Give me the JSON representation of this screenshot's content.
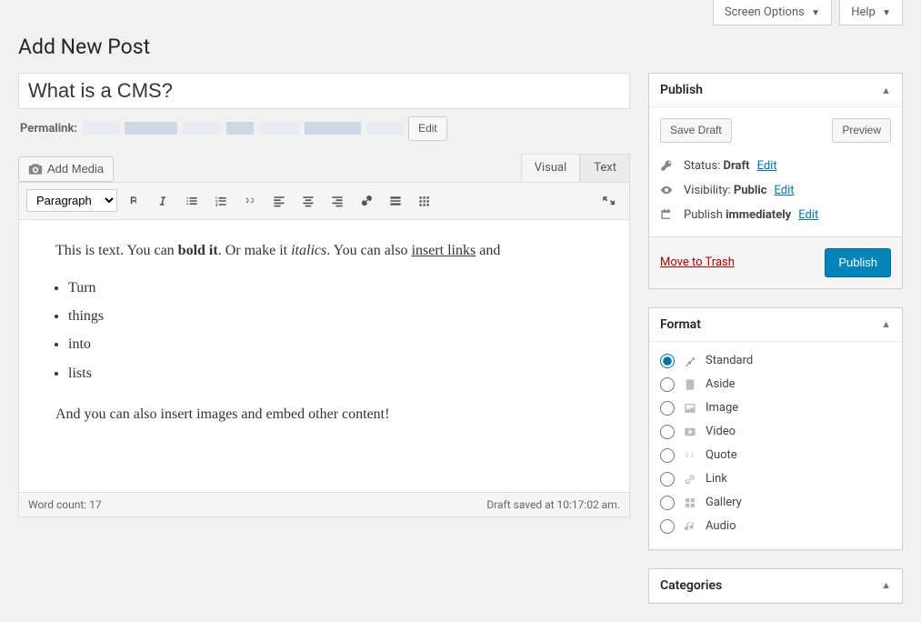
{
  "topTabs": {
    "screenOptions": "Screen Options",
    "help": "Help"
  },
  "pageTitle": "Add New Post",
  "post": {
    "title": "What is a CMS?",
    "permalinkLabel": "Permalink:",
    "editBtn": "Edit"
  },
  "mediaBtn": "Add Media",
  "editorTabs": {
    "visual": "Visual",
    "text": "Text"
  },
  "toolbar": {
    "paragraph": "Paragraph"
  },
  "content": {
    "line1_a": "This is text. You can ",
    "line1_bold": "bold it",
    "line1_b": ". Or make it ",
    "line1_italic": "italics",
    "line1_c": ". You can also ",
    "line1_link": "insert links",
    "line1_d": " and",
    "list": [
      "Turn",
      "things",
      "into",
      "lists"
    ],
    "line2": "And you can also insert images and embed other content!"
  },
  "footer": {
    "wordCountLabel": "Word count: ",
    "wordCount": "17",
    "saved": "Draft saved at 10:17:02 am."
  },
  "publish": {
    "heading": "Publish",
    "saveDraft": "Save Draft",
    "preview": "Preview",
    "statusLabel": "Status: ",
    "statusValue": "Draft",
    "visibilityLabel": "Visibility: ",
    "visibilityValue": "Public",
    "publishLabel": "Publish ",
    "publishValue": "immediately",
    "editLink": "Edit",
    "trash": "Move to Trash",
    "publishBtn": "Publish"
  },
  "format": {
    "heading": "Format",
    "items": [
      {
        "label": "Standard"
      },
      {
        "label": "Aside"
      },
      {
        "label": "Image"
      },
      {
        "label": "Video"
      },
      {
        "label": "Quote"
      },
      {
        "label": "Link"
      },
      {
        "label": "Gallery"
      },
      {
        "label": "Audio"
      }
    ]
  },
  "categories": {
    "heading": "Categories"
  }
}
